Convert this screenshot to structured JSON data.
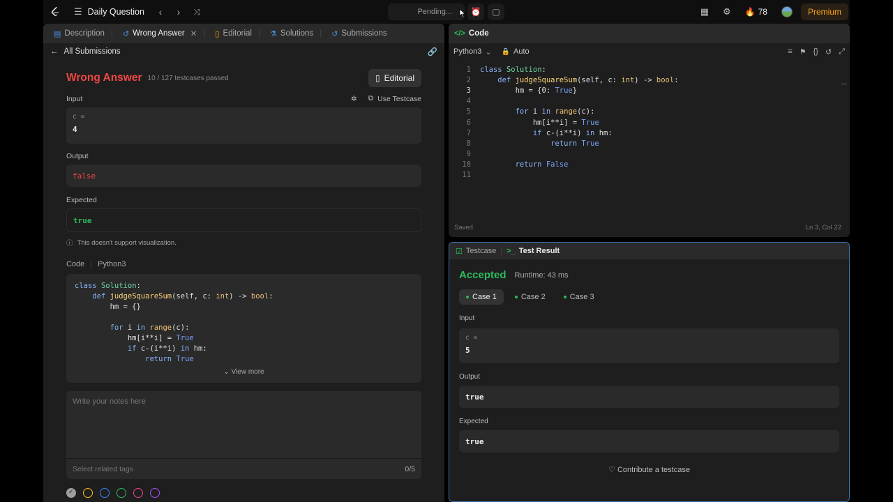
{
  "topbar": {
    "daily_label": "Daily Question",
    "status": "Pending...",
    "streak": "78",
    "premium": "Premium"
  },
  "left": {
    "tabs": [
      {
        "label": "Description",
        "icon": "description-icon"
      },
      {
        "label": "Wrong Answer",
        "icon": "history-icon"
      },
      {
        "label": "Editorial",
        "icon": "book-icon"
      },
      {
        "label": "Solutions",
        "icon": "flask-icon"
      },
      {
        "label": "Submissions",
        "icon": "history-icon"
      }
    ],
    "back_label": "All Submissions",
    "result_title": "Wrong Answer",
    "testcases": "10 / 127 testcases passed",
    "editorial_btn": "Editorial",
    "input_label": "Input",
    "use_testcase": "Use Testcase",
    "input_var": "c =",
    "input_val": "4",
    "output_label": "Output",
    "output_val": "false",
    "expected_label": "Expected",
    "expected_val": "true",
    "viz_note": "This doesn't support visualization.",
    "code_label": "Code",
    "code_lang": "Python3",
    "view_more": "View more",
    "notes_placeholder": "Write your notes here",
    "tags_placeholder": "Select related tags",
    "tags_count": "0/5",
    "color_dots": [
      "#9e9e9e",
      "#ffc01e",
      "#3b82f6",
      "#2cbb5d",
      "#ec4899",
      "#a855f7"
    ]
  },
  "codepanel": {
    "title": "Code",
    "lang": "Python3",
    "mode": "Auto",
    "saved": "Saved",
    "cursor": "Ln 3, Col 22"
  },
  "result": {
    "tab_testcase": "Testcase",
    "tab_result": "Test Result",
    "status": "Accepted",
    "runtime": "Runtime: 43 ms",
    "cases": [
      "Case 1",
      "Case 2",
      "Case 3"
    ],
    "input_label": "Input",
    "input_var": "c =",
    "input_val": "5",
    "output_label": "Output",
    "output_val": "true",
    "expected_label": "Expected",
    "expected_val": "true",
    "contribute": "Contribute a testcase"
  }
}
